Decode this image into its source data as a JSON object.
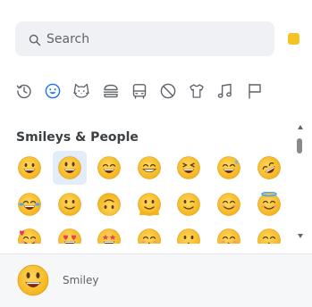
{
  "search": {
    "placeholder": "Search",
    "icon": "search-icon"
  },
  "skin_tone": {
    "color": "#f6c325"
  },
  "categories": [
    {
      "name": "recent",
      "icon": "clock-icon",
      "active": false
    },
    {
      "name": "smileys-people",
      "icon": "smiley-icon",
      "active": true
    },
    {
      "name": "animals-nature",
      "icon": "cat-icon",
      "active": false
    },
    {
      "name": "food-drink",
      "icon": "burger-icon",
      "active": false
    },
    {
      "name": "travel-places",
      "icon": "bus-icon",
      "active": false
    },
    {
      "name": "activities",
      "icon": "ball-icon",
      "active": false
    },
    {
      "name": "objects",
      "icon": "shirt-icon",
      "active": false
    },
    {
      "name": "symbols",
      "icon": "music-note-icon",
      "active": false
    },
    {
      "name": "flags",
      "icon": "flag-icon",
      "active": false
    }
  ],
  "section": {
    "title": "Smileys & People"
  },
  "emojis": [
    "grinning-face",
    "smiley",
    "smile",
    "grin",
    "laughing",
    "sweat-smile",
    "rofl",
    "joy",
    "slightly-smiling",
    "upside-down",
    "melting",
    "wink",
    "blush",
    "innocent",
    "smiling-hearts",
    "heart-eyes",
    "star-struck",
    "kissing",
    "kissing-face",
    "kissing-closed-eyes",
    "kissing-smiling-eyes"
  ],
  "selected_emoji": "smiley",
  "preview": {
    "name": "Smiley",
    "emoji": "smiley"
  },
  "colors": {
    "accent": "#1a73e8",
    "emoji_yellow": "#f6c325",
    "selection_bg": "#e3ecf9"
  }
}
